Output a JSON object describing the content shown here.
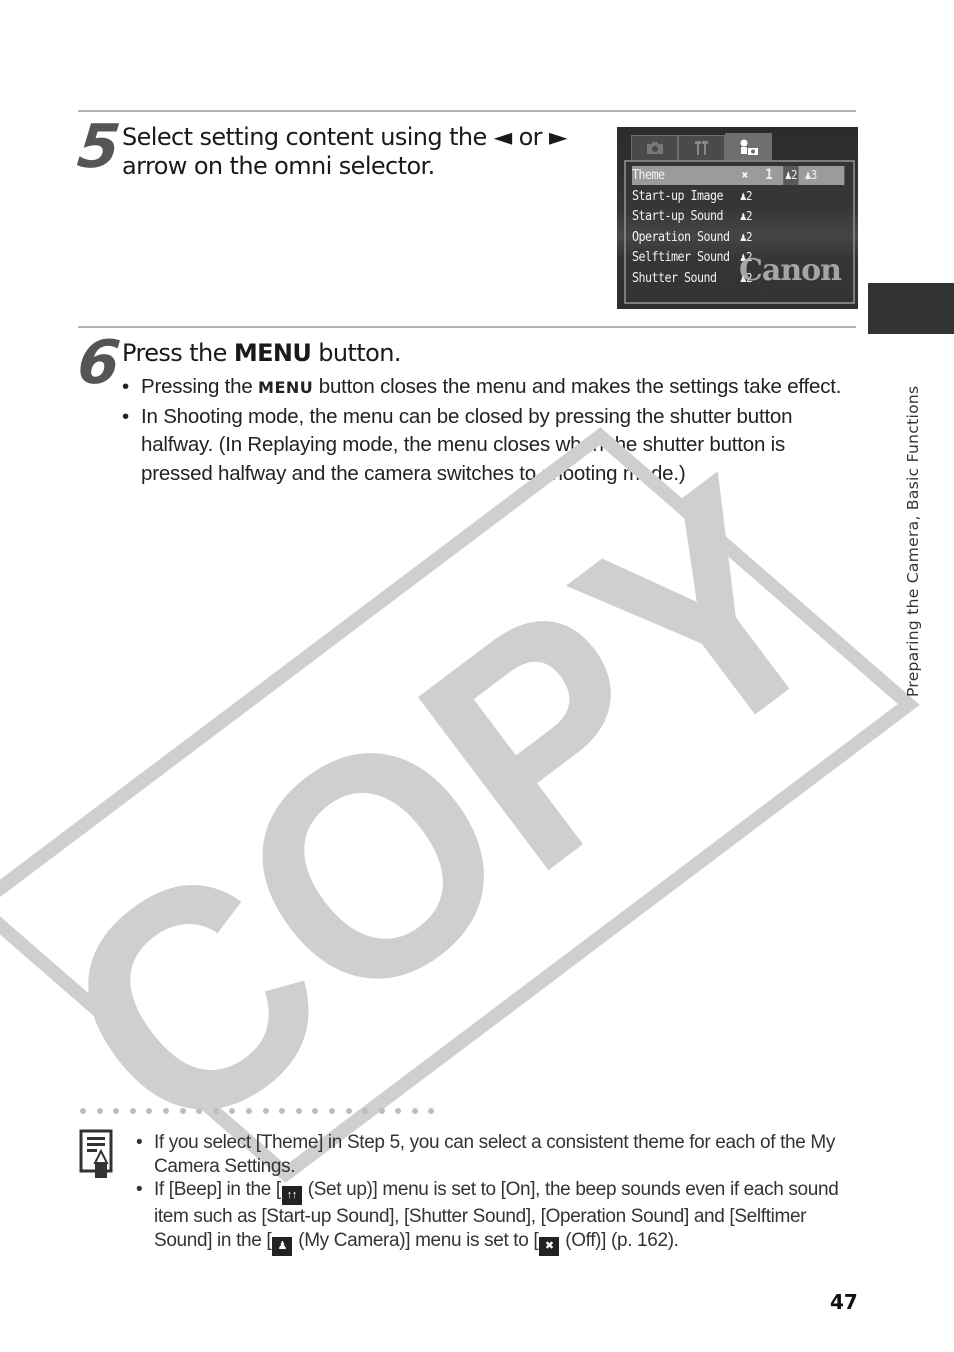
{
  "step5": {
    "number": "5",
    "title_line1": "Select setting content using the ◄ or ►",
    "title_line2": "arrow on the omni selector."
  },
  "camera_screen": {
    "tabs": [
      {
        "icon": "camera-icon",
        "glyph": "■",
        "active": false
      },
      {
        "icon": "setup-tools-icon",
        "glyph": "Ӹ",
        "active": false
      },
      {
        "icon": "my-camera-icon",
        "glyph": "♟▪",
        "active": true
      }
    ],
    "rows": [
      {
        "label": "Theme",
        "value": "",
        "selected": true
      },
      {
        "label": "Start-up Image",
        "value": "③"
      },
      {
        "label": "Start-up Sound",
        "value": "③"
      },
      {
        "label": "Operation Sound",
        "value": "③"
      },
      {
        "label": "Selftimer Sound",
        "value": "③"
      },
      {
        "label": "Shutter Sound",
        "value": "③"
      }
    ],
    "theme_options": [
      "✖",
      "1",
      "2",
      "3"
    ],
    "brand": "Canon"
  },
  "step6": {
    "number": "6",
    "title_prefix": "Press the ",
    "title_keyword": "MENU",
    "title_suffix": " button.",
    "bullets": [
      {
        "prefix": "Pressing the ",
        "keyword": "MENU",
        "suffix": " button closes the menu and makes the settings take effect."
      },
      {
        "text": "In Shooting mode, the menu can be closed by pressing the shutter button halfway. (In Replaying mode, the menu closes when the shutter button is pressed halfway and the camera switches to shooting mode.)"
      }
    ]
  },
  "watermark": "COPY",
  "note": {
    "icon": "note-pencil-icon",
    "bullets": [
      {
        "text": "If you select [Theme] in Step 5, you can select a consistent theme for each of the My Camera Settings."
      },
      {
        "part1": "If [Beep] in the [",
        "icon1": "set-up-icon",
        "part2": " (Set up)] menu is set to [On], the beep sounds even if each sound item such as [Start-up Sound], [Shutter Sound], [Operation Sound] and [Selftimer Sound] in the [",
        "icon2": "my-camera-icon",
        "part3": " (My Camera)] menu is set to [",
        "icon3": "off-icon",
        "part4": " (Off)] (p. 162)."
      }
    ]
  },
  "side_tab": {
    "text": "Preparing the Camera, Basic Functions"
  },
  "page_number": "47"
}
